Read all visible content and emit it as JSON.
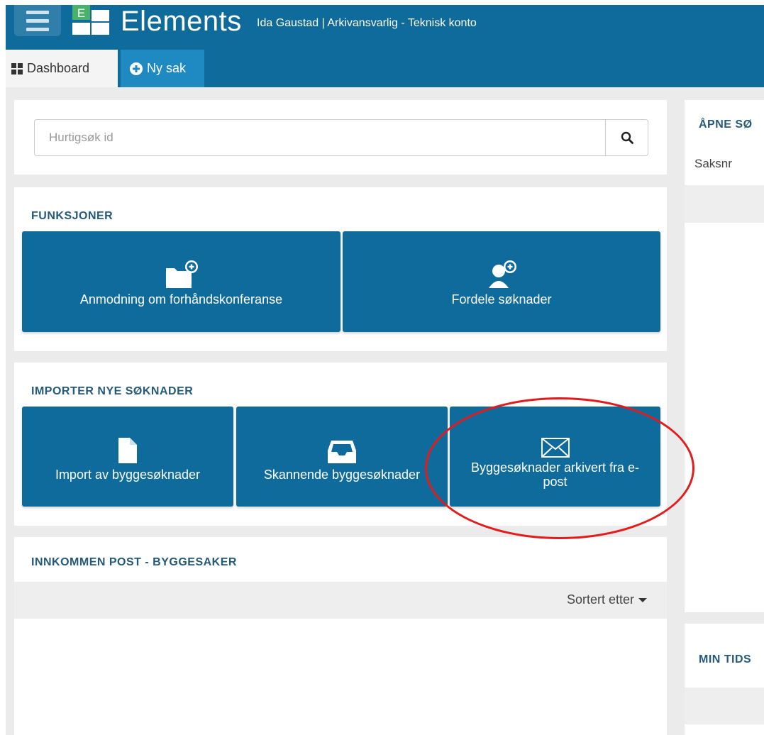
{
  "header": {
    "app_name": "Elements",
    "logo_letter": "E",
    "user": "Ida Gaustad | Arkivansvarlig - Teknisk konto",
    "tabs": [
      {
        "label": "Dashboard",
        "icon": "grid-icon"
      },
      {
        "label": "Ny sak",
        "icon": "plus-circle-icon"
      }
    ]
  },
  "search": {
    "placeholder": "Hurtigsøk id",
    "value": ""
  },
  "funksjoner": {
    "title": "FUNKSJONER",
    "items": [
      {
        "label": "Anmodning om forhåndskonferanse",
        "icon": "folder-plus-icon"
      },
      {
        "label": "Fordele søknader",
        "icon": "user-plus-icon"
      }
    ]
  },
  "importer": {
    "title": "IMPORTER NYE SØKNADER",
    "items": [
      {
        "label": "Import av byggesøknader",
        "icon": "file-icon"
      },
      {
        "label": "Skannende byggesøknader",
        "icon": "inbox-icon"
      },
      {
        "label": "Byggesøknader arkivert fra e-post",
        "icon": "envelope-icon"
      }
    ]
  },
  "post": {
    "title": "INNKOMMEN POST - BYGGESAKER",
    "sort_label": "Sortert etter"
  },
  "right": {
    "panel1_title": "ÅPNE SØ",
    "panel1_sub": "Saksnr",
    "panel2_title": "MIN TIDS"
  },
  "colors": {
    "primary": "#0f6b9b",
    "tab_active": "#1f89c2",
    "section_title": "#24597a",
    "highlight": "#e31b1b"
  }
}
